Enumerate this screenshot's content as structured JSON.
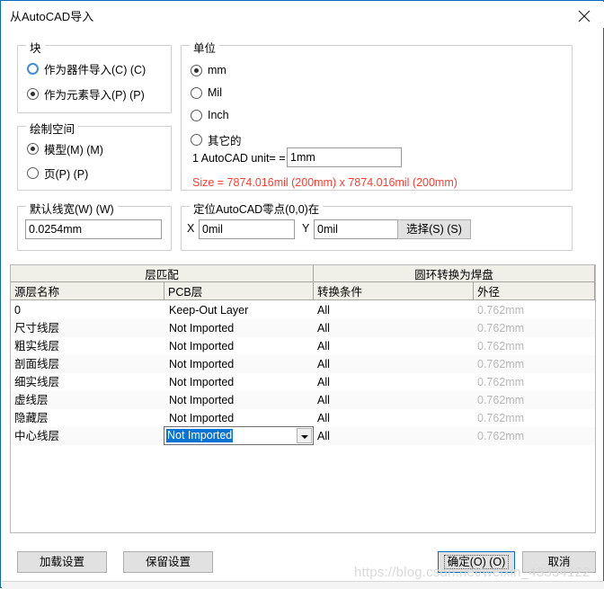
{
  "window": {
    "title": "从AutoCAD导入",
    "close_icon": "close-icon",
    "accent_color": "#0a6bbd"
  },
  "block_group": {
    "title": "块",
    "options": [
      {
        "label": "作为器件导入(C) (C)",
        "checked": false,
        "hover": true
      },
      {
        "label": "作为元素导入(P) (P)",
        "checked": true,
        "hover": false
      }
    ]
  },
  "drawing_space_group": {
    "title": "绘制空间",
    "options": [
      {
        "label": "模型(M) (M)",
        "checked": true
      },
      {
        "label": "页(P) (P)",
        "checked": false
      }
    ]
  },
  "default_line_width_group": {
    "title": "默认线宽(W) (W)",
    "value": "0.0254mm"
  },
  "units_group": {
    "title": "单位",
    "options": [
      {
        "label": "mm",
        "checked": true
      },
      {
        "label": "Mil",
        "checked": false
      },
      {
        "label": "Inch",
        "checked": false
      },
      {
        "label": "其它的",
        "checked": false
      }
    ],
    "unit_label": "1 AutoCAD unit= =",
    "unit_value": "1mm",
    "size_text": "Size = 7874.016mil (200mm) x 7874.016mil (200mm)",
    "size_color": "#ff3b30"
  },
  "origin_group": {
    "title": "定位AutoCAD零点(0,0)在",
    "x_label": "X",
    "x_value": "0mil",
    "y_label": "Y",
    "y_value": "0mil",
    "select_button": "选择(S) (S)"
  },
  "table": {
    "group_headers": [
      {
        "label": "层匹配"
      },
      {
        "label": "圆环转换为焊盘"
      }
    ],
    "columns": [
      "源层名称",
      "PCB层",
      "转换条件",
      "外径"
    ],
    "rows": [
      {
        "source": "0",
        "pcb": "Keep-Out Layer",
        "cond": "All",
        "diam": "0.762mm",
        "editing": false
      },
      {
        "source": "尺寸线层",
        "pcb": "Not Imported",
        "cond": "All",
        "diam": "0.762mm",
        "editing": false
      },
      {
        "source": "粗实线层",
        "pcb": "Not Imported",
        "cond": "All",
        "diam": "0.762mm",
        "editing": false
      },
      {
        "source": "剖面线层",
        "pcb": "Not Imported",
        "cond": "All",
        "diam": "0.762mm",
        "editing": false
      },
      {
        "source": "细实线层",
        "pcb": "Not Imported",
        "cond": "All",
        "diam": "0.762mm",
        "editing": false
      },
      {
        "source": "虚线层",
        "pcb": "Not Imported",
        "cond": "All",
        "diam": "0.762mm",
        "editing": false
      },
      {
        "source": "隐藏层",
        "pcb": "Not Imported",
        "cond": "All",
        "diam": "0.762mm",
        "editing": false
      },
      {
        "source": "中心线层",
        "pcb": "Not Imported",
        "cond": "All",
        "diam": "0.762mm",
        "editing": true
      }
    ]
  },
  "footer": {
    "load_settings": "加载设置",
    "save_settings": "保留设置",
    "ok": "确定(O) (O)",
    "cancel": "取消"
  },
  "watermark": {
    "text": "https://blog.csdn.net/weixin_43334122"
  }
}
